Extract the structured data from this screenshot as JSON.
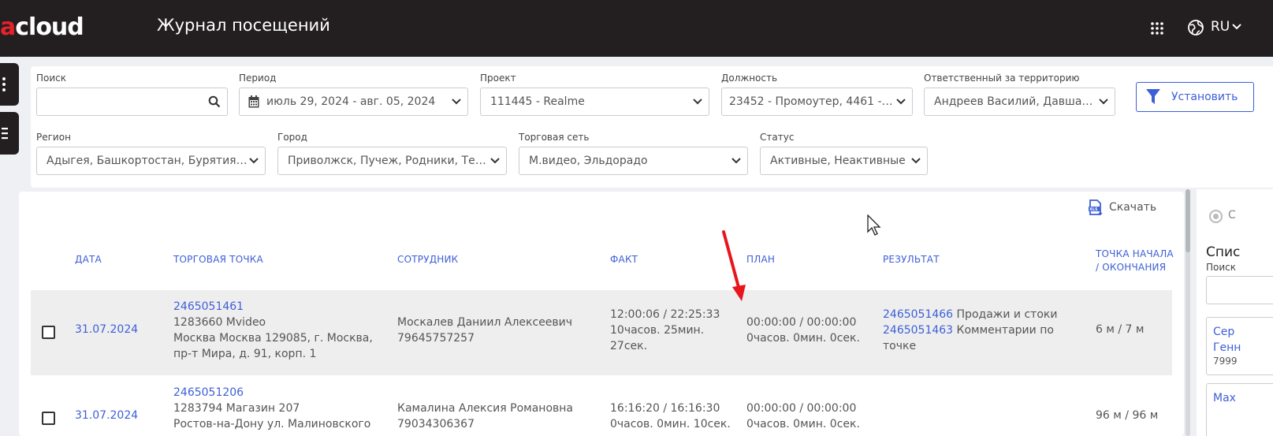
{
  "header": {
    "logo_accent": "a",
    "logo_rest": "cloud",
    "title": "Журнал посещений",
    "lang": "RU"
  },
  "filters": {
    "search": {
      "label": "Поиск",
      "value": ""
    },
    "period": {
      "label": "Период",
      "value": "июль 29, 2024 - авг. 05, 2024"
    },
    "project": {
      "label": "Проект",
      "value": "111445 - Realme"
    },
    "position": {
      "label": "Должность",
      "value": "23452 - Промоутер, 4461 - К..."
    },
    "responsible": {
      "label": "Ответственный за территорию",
      "value": "Андреев Василий, Давшан ..."
    },
    "region": {
      "label": "Регион",
      "value": "Адыгея, Башкортостан, Бурятия, А..."
    },
    "city": {
      "label": "Город",
      "value": "Приволжск, Пучеж, Родники, Тейко..."
    },
    "chain": {
      "label": "Торговая сеть",
      "value": "М.видео, Эльдорадо"
    },
    "status": {
      "label": "Статус",
      "value": "Активные, Неактивные"
    },
    "apply_label": "Установить"
  },
  "table": {
    "download_label": "Скачать",
    "headers": {
      "date": "ДАТА",
      "store": "ТОРГОВАЯ ТОЧКА",
      "employee": "СОТРУДНИК",
      "fact": "ФАКТ",
      "plan": "ПЛАН",
      "result": "РЕЗУЛЬТАТ",
      "point_l1": "ТОЧКА НАЧАЛА",
      "point_l2": "/ ОКОНЧАНИЯ"
    },
    "rows": [
      {
        "date": "31.07.2024",
        "store_id": "2465051461",
        "store_name": "1283660 Mvideo",
        "store_addr1": "Москва Москва 129085, г. Москва,",
        "store_addr2": "пр-т Мира, д. 91, корп. 1",
        "employee_name": "Москалев Даниил Алексеевич",
        "employee_phone": "79645757257",
        "fact_time": "12:00:06 / 22:25:33",
        "fact_dur1": "10часов. 25мин.",
        "fact_dur2": "27сек.",
        "plan_time": "00:00:00 / 00:00:00",
        "plan_dur": "0часов. 0мин. 0сек.",
        "result1_id": "2465051466",
        "result1_text": " Продажи и стоки",
        "result2_id": "2465051463",
        "result2_text": " Комментарии по",
        "result2_text2": "точке",
        "point": "6 м / 7 м"
      },
      {
        "date": "31.07.2024",
        "store_id": "2465051206",
        "store_name": "1283794 Магазин 207",
        "store_addr1": "Ростов-на-Дону ул. Малиновского",
        "employee_name": "Камалина Алексия Романовна",
        "employee_phone": "79034306367",
        "fact_time": "16:16:20 / 16:16:30",
        "fact_dur1": "0часов. 0мин. 10сек.",
        "plan_time": "00:00:00 / 00:00:00",
        "plan_dur": "0часов. 0мин. 0сек.",
        "point": "96 м / 96 м"
      }
    ]
  },
  "right_panel": {
    "radio_label": "С",
    "list_title": "Спис",
    "search_label": "Поиск",
    "card1_l1": "Сер",
    "card1_l2": "Генн",
    "card1_phone": "7999",
    "card2_l1": "Мах"
  },
  "colors": {
    "header_bg": "#231f20",
    "accent": "#3d5fd6",
    "logo_red": "#e4222b",
    "annotation_red": "#e8151b"
  }
}
